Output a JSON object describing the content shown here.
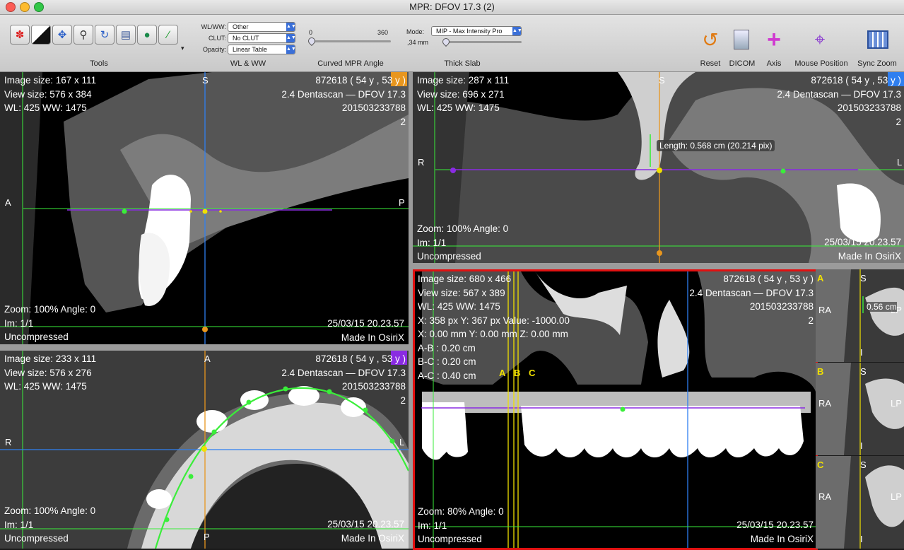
{
  "window": {
    "title": "MPR: DFOV 17.3 (2)"
  },
  "toolbar": {
    "groups": {
      "tools": "Tools",
      "wlww": "WL & WW",
      "curved": "Curved MPR Angle",
      "thick": "Thick Slab"
    },
    "wl_label": "WL/WW:",
    "wl_value": "Other",
    "clut_label": "CLUT:",
    "clut_value": "No CLUT",
    "opacity_label": "Opacity:",
    "opacity_value": "Linear Table",
    "angle_min": "0",
    "angle_max": "360",
    "angle_value": 0,
    "mode_label": "Mode:",
    "mode_value": "MIP - Max Intensity Pro",
    "slab_value": ",34 mm",
    "buttons": {
      "reset": "Reset",
      "dicom": "DICOM",
      "axis": "Axis",
      "mouse": "Mouse Position",
      "sync": "Sync Zoom"
    }
  },
  "views": {
    "sagittal": {
      "image_size": "Image size: 167 x 111",
      "view_size": "View size: 576 x 384",
      "wl": "WL: 425 WW: 1475",
      "patient": "872618 ( 54 y , 53 y )",
      "study": "2.4 Dentascan — DFOV 17.3",
      "id": "201503233788",
      "num": "2",
      "zoom": "Zoom: 100% Angle: 0",
      "im": "Im: 1/1",
      "date": "25/03/15 20.23.57",
      "compression": "Uncompressed",
      "made": "Made In OsiriX",
      "marks": {
        "top": "S",
        "left": "A",
        "right": "P"
      }
    },
    "axial": {
      "image_size": "Image size: 233 x 111",
      "view_size": "View size: 576 x 276",
      "wl": "WL: 425 WW: 1475",
      "patient": "872618 ( 54 y , 53 y )",
      "study": "2.4 Dentascan — DFOV 17.3",
      "id": "201503233788",
      "num": "2",
      "zoom": "Zoom: 100% Angle: 0",
      "im": "Im: 1/1",
      "date": "25/03/15 20.23.57",
      "compression": "Uncompressed",
      "made": "Made In OsiriX",
      "marks": {
        "top": "A",
        "left": "R",
        "right": "L",
        "bottom": "P"
      }
    },
    "coronal": {
      "image_size": "Image size: 287 x 111",
      "view_size": "View size: 696 x 271",
      "wl": "WL: 425 WW: 1475",
      "patient": "872618 ( 54 y , 53 y )",
      "study": "2.4 Dentascan — DFOV 17.3",
      "id": "201503233788",
      "num": "2",
      "zoom": "Zoom: 100% Angle: 0",
      "im": "Im: 1/1",
      "date": "25/03/15 20.23.57",
      "compression": "Uncompressed",
      "made": "Made In OsiriX",
      "marks": {
        "top": "S",
        "left": "R",
        "right": "L"
      },
      "measurement": "Length: 0.568 cm (20.214 pix)"
    },
    "curved": {
      "image_size": "Image size: 680 x 466",
      "view_size": "View size: 567 x 389",
      "wl": "WL: 425 WW: 1475",
      "pixel": "X: 358 px Y: 367 px Value: -1000.00",
      "mm": "X: 0.00 mm Y: 0.00 mm Z: 0.00 mm",
      "ab": "A-B : 0.20 cm",
      "bc": "B-C : 0.20 cm",
      "ac": "A-C : 0.40 cm",
      "patient": "872618 ( 54 y , 53 y )",
      "study": "2.4 Dentascan — DFOV 17.3",
      "id": "201503233788",
      "num": "2",
      "zoom": "Zoom: 80% Angle: 0",
      "im": "Im: 1/1",
      "date": "25/03/15 20.23.57",
      "compression": "Uncompressed",
      "made": "Made In OsiriX",
      "line_labels": [
        "A",
        "B",
        "C"
      ]
    },
    "thumbs": [
      {
        "letter": "A",
        "top": "S",
        "left": "RA",
        "right": "LP",
        "bottom": "I",
        "measure": "0.56 cm"
      },
      {
        "letter": "B",
        "top": "S",
        "left": "RA",
        "right": "LP",
        "bottom": "I"
      },
      {
        "letter": "C",
        "top": "S",
        "left": "RA",
        "right": "LP",
        "bottom": "I"
      }
    ]
  },
  "colors": {
    "active_border": "#e01010",
    "purple": "#8a2be2",
    "orange": "#e8961e",
    "blue": "#2f7ff0",
    "green": "#33ee33",
    "yellow": "#f0e000"
  }
}
